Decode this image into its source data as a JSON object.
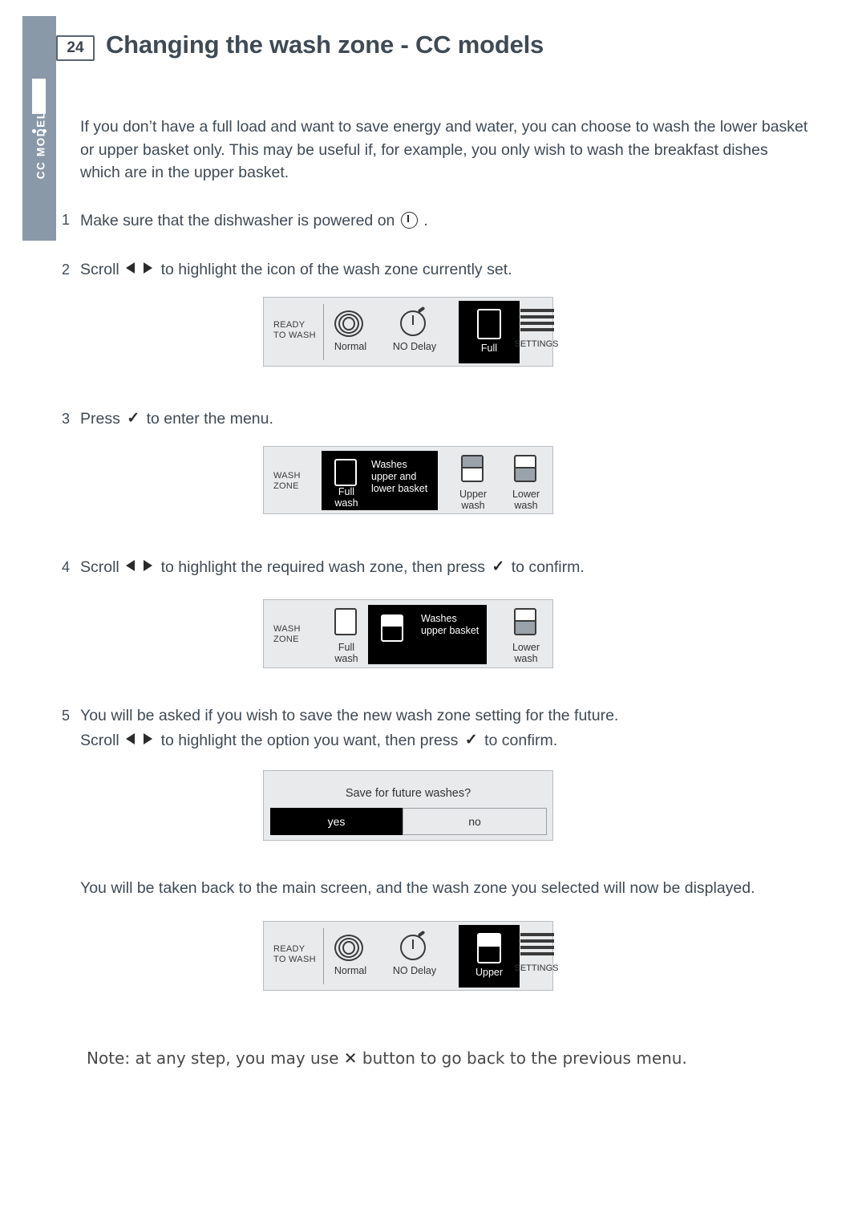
{
  "page": {
    "number": "24",
    "title_main": "Changing the wash zone",
    "title_sub": "- CC models",
    "side_tab_label": "CC MODELS"
  },
  "intro": "If you don’t have a full load and want to save energy and water, you can choose to wash the lower basket or upper basket only. This may be useful if, for example, you only wish to wash the breakfast dishes which are in the upper basket.",
  "steps": [
    {
      "num": "1",
      "text_before": "Make sure that the dishwasher is powered on",
      "text_after": "."
    },
    {
      "num": "2",
      "text_before": "Scroll",
      "text_after": "to highlight the icon of the wash zone currently set."
    },
    {
      "num": "3",
      "text_before": "Press",
      "text_after": "to enter the menu."
    },
    {
      "num": "4",
      "text_before": "Scroll",
      "text_mid": "to highlight the required wash zone, then press",
      "text_after": "to confirm."
    },
    {
      "num": "5",
      "line1": "You will be asked if you wish to save the new wash zone setting for the future.",
      "text_before": "Scroll",
      "text_mid": "to highlight the option you want, then press",
      "text_after": "to confirm."
    }
  ],
  "closing": "You will be taken back to the main screen, and the wash zone you selected will now be displayed.",
  "note": {
    "before": "Note: at any step, you may use",
    "glyph": "✕",
    "after": "button to go back to the previous menu."
  },
  "panel_main_1": {
    "status_line1": "READY",
    "status_line2": "TO WASH",
    "cycle_label": "Normal",
    "delay_label": "NO Delay",
    "zone_label": "Full",
    "settings_label": "SETTINGS"
  },
  "panel_menu_1": {
    "title_line1": "WASH",
    "title_line2": "ZONE",
    "bubble": "Washes upper and lower basket",
    "opt1_line1": "Full",
    "opt1_line2": "wash",
    "opt2_line1": "Upper",
    "opt2_line2": "wash",
    "opt3_line1": "Lower",
    "opt3_line2": "wash"
  },
  "panel_menu_2": {
    "title_line1": "WASH",
    "title_line2": "ZONE",
    "bubble": "Washes upper basket",
    "opt1_line1": "Full",
    "opt1_line2": "wash",
    "opt3_line1": "Lower",
    "opt3_line2": "wash"
  },
  "panel_save": {
    "question": "Save for future washes?",
    "yes": "yes",
    "no": "no"
  },
  "panel_main_2": {
    "status_line1": "READY",
    "status_line2": "TO WASH",
    "cycle_label": "Normal",
    "delay_label": "NO Delay",
    "zone_label": "Upper",
    "settings_label": "SETTINGS"
  },
  "colors": {
    "tab": "#8a99a8",
    "title": "#3f4a55",
    "panel_bg": "#e9eaec",
    "selected": "#000000",
    "basket_fill": "#9aa2aa"
  }
}
